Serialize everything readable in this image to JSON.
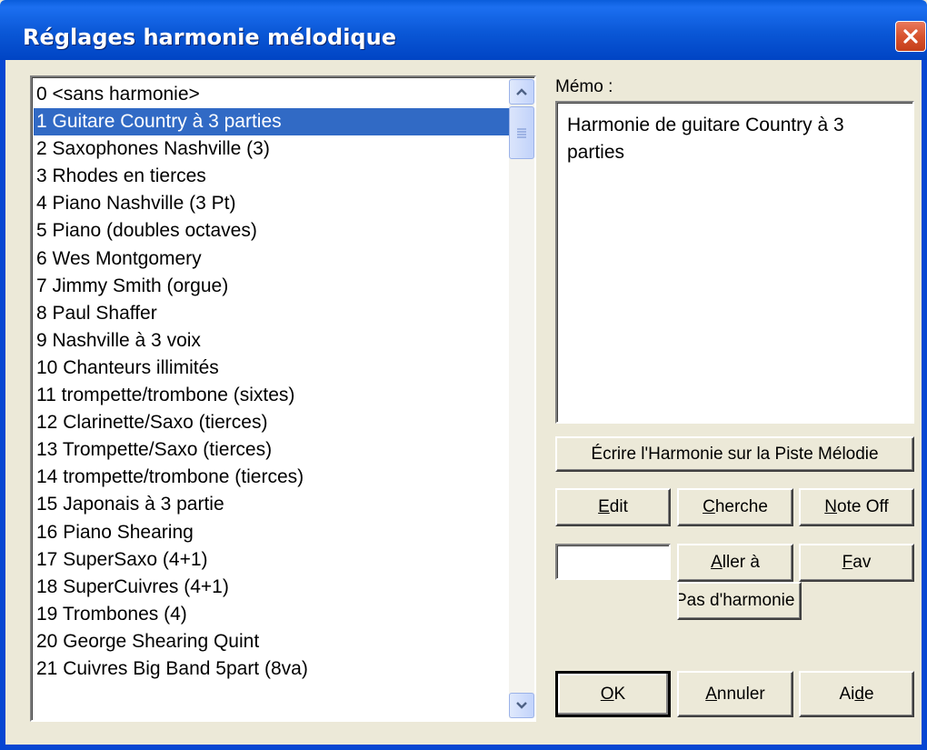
{
  "window": {
    "title": "Réglages harmonie mélodique"
  },
  "harmony_list": {
    "selected_index": 1,
    "items": [
      "0 <sans harmonie>",
      "1 Guitare Country à 3 parties",
      "2 Saxophones Nashville (3)",
      "3 Rhodes en tierces",
      "4 Piano Nashville (3 Pt)",
      "5 Piano (doubles octaves)",
      "6 Wes Montgomery",
      "7 Jimmy Smith (orgue)",
      "8 Paul Shaffer",
      "9 Nashville à 3 voix",
      "10 Chanteurs illimités",
      "11 trompette/trombone (sixtes)",
      "12 Clarinette/Saxo (tierces)",
      "13 Trompette/Saxo (tierces)",
      "14 trompette/trombone (tierces)",
      "15 Japonais à 3 partie",
      "16 Piano Shearing",
      "17 SuperSaxo (4+1)",
      "18 SuperCuivres (4+1)",
      "19 Trombones (4)",
      "20 George Shearing Quint",
      "21 Cuivres Big Band 5part (8va)"
    ]
  },
  "memo": {
    "label": "Mémo :",
    "text": "Harmonie de guitare Country à 3 parties"
  },
  "buttons": {
    "write_harmony": "Écrire l'Harmonie sur la Piste Mélodie",
    "edit": "Edit",
    "search": "Cherche",
    "note_off": "Note Off",
    "goto": "Aller à",
    "fav": "Fav",
    "no_harmony": "Pas d'harmonie",
    "ok": "OK",
    "cancel": "Annuler",
    "help": "Aide"
  },
  "goto_input": {
    "value": ""
  },
  "colors": {
    "title_bar": "#0a57d6",
    "selection": "#316ac5",
    "dialog_face": "#ece9d8",
    "close_button": "#d8532e"
  }
}
